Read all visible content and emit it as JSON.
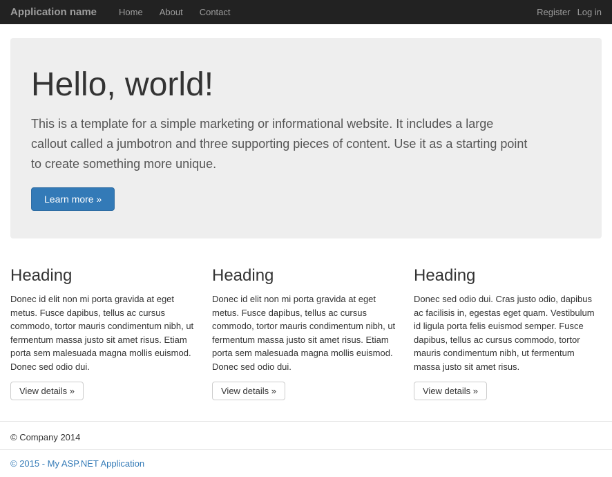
{
  "navbar": {
    "brand": "Application name",
    "nav_home": "Home",
    "nav_about": "About",
    "nav_contact": "Contact",
    "register": "Register",
    "login": "Log in"
  },
  "jumbotron": {
    "heading": "Hello, world!",
    "description": "This is a template for a simple marketing or informational website. It includes a large callout called a jumbotron and three supporting pieces of content. Use it as a starting point to create something more unique.",
    "button_label": "Learn more »"
  },
  "columns": [
    {
      "heading": "Heading",
      "body": "Donec id elit non mi porta gravida at eget metus. Fusce dapibus, tellus ac cursus commodo, tortor mauris condimentum nibh, ut fermentum massa justo sit amet risus. Etiam porta sem malesuada magna mollis euismod. Donec sed odio dui.",
      "button": "View details »"
    },
    {
      "heading": "Heading",
      "body": "Donec id elit non mi porta gravida at eget metus. Fusce dapibus, tellus ac cursus commodo, tortor mauris condimentum nibh, ut fermentum massa justo sit amet risus. Etiam porta sem malesuada magna mollis euismod. Donec sed odio dui.",
      "button": "View details »"
    },
    {
      "heading": "Heading",
      "body": "Donec sed odio dui. Cras justo odio, dapibus ac facilisis in, egestas eget quam. Vestibulum id ligula porta felis euismod semper. Fusce dapibus, tellus ac cursus commodo, tortor mauris condimentum nibh, ut fermentum massa justo sit amet risus.",
      "button": "View details »"
    }
  ],
  "footer": {
    "copyright": "© Company 2014",
    "asp_footer": "© 2015 - My ASP.NET Application"
  }
}
